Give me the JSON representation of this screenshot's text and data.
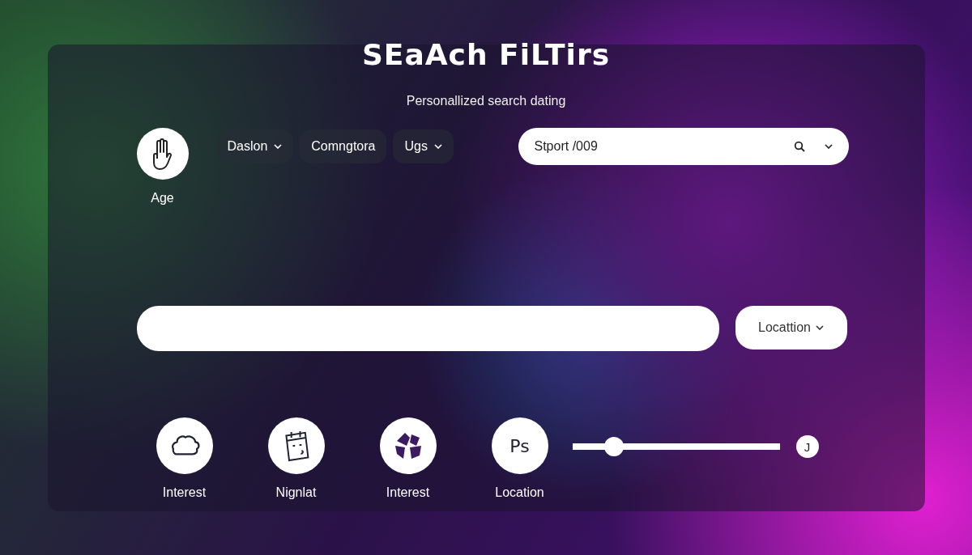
{
  "title": "SEaAch FiLTirs",
  "subtitle": "Personallized search dating",
  "age": {
    "label": "Age"
  },
  "chips": [
    {
      "label": "Daslon",
      "kind": "dropdown"
    },
    {
      "label": "Comngtora",
      "kind": "button"
    },
    {
      "label": "Ugs",
      "kind": "dropdown"
    }
  ],
  "search": {
    "value": "Stport /009"
  },
  "location_dropdown": {
    "label": "Locattion"
  },
  "categories": [
    {
      "label": "Interest",
      "kind": "chat"
    },
    {
      "label": "Nignlat",
      "kind": "calendar"
    },
    {
      "label": "Interest",
      "kind": "shapes"
    },
    {
      "label": "Location",
      "kind": "glyph",
      "glyph": "Ps"
    }
  ],
  "slider": {
    "level": 0.2,
    "end_label": "J"
  }
}
